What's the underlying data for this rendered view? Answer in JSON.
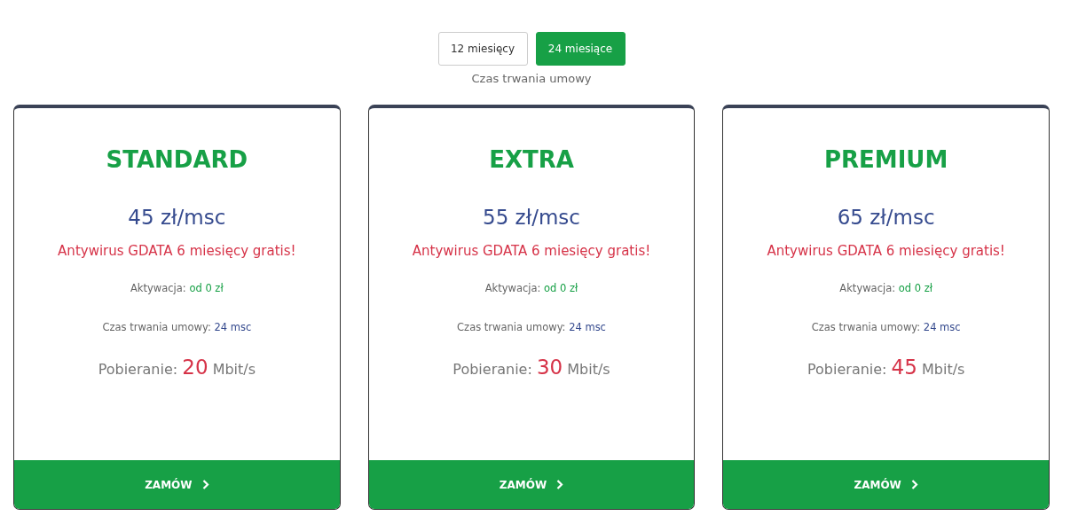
{
  "period_toggle": {
    "options": [
      {
        "label": "12 miesięcy",
        "selected": false
      },
      {
        "label": "24 miesiące",
        "selected": true
      }
    ],
    "caption": "Czas trwania umowy"
  },
  "plans": [
    {
      "name": "STANDARD",
      "price": "45 zł/msc",
      "promo": "Antywirus GDATA 6 miesięcy gratis!",
      "activation_label": "Aktywacja:",
      "activation_value": "od 0 zł",
      "contract_label": "Czas trwania umowy:",
      "contract_value": "24 msc",
      "download_label": "Pobieranie:",
      "download_value": "20",
      "download_unit": "Mbit/s",
      "order_button": "ZAMÓW"
    },
    {
      "name": "EXTRA",
      "price": "55 zł/msc",
      "promo": "Antywirus GDATA 6 miesięcy gratis!",
      "activation_label": "Aktywacja:",
      "activation_value": "od 0 zł",
      "contract_label": "Czas trwania umowy:",
      "contract_value": "24 msc",
      "download_label": "Pobieranie:",
      "download_value": "30",
      "download_unit": "Mbit/s",
      "order_button": "ZAMÓW"
    },
    {
      "name": "PREMIUM",
      "price": "65 zł/msc",
      "promo": "Antywirus GDATA 6 miesięcy gratis!",
      "activation_label": "Aktywacja:",
      "activation_value": "od 0 zł",
      "contract_label": "Czas trwania umowy:",
      "contract_value": "24 msc",
      "download_label": "Pobieranie:",
      "download_value": "45",
      "download_unit": "Mbit/s",
      "order_button": "ZAMÓW"
    }
  ]
}
